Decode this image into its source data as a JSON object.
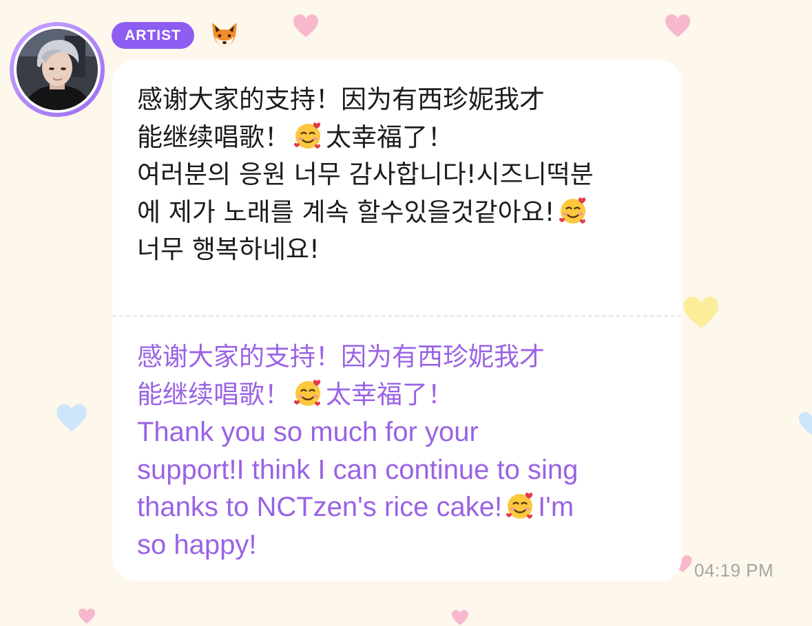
{
  "message": {
    "badge": "ARTIST",
    "sender_icon": "fox-icon",
    "original_lines": [
      "感谢大家的支持！因为有西珍妮我才",
      "能继续唱歌！",
      "太幸福了！",
      "여러분의 응원 너무 감사합니다!시즈니떡분",
      "에 제가 노래를 계속 할수있을것같아요!",
      "너무 행복하네요!"
    ],
    "translation_lines": [
      "感谢大家的支持！因为有西珍妮我才",
      "能继续唱歌！",
      "太幸福了！",
      "Thank you so much for your",
      "support!I think I can continue to sing",
      "thanks to NCTzen's rice cake!",
      "I'm",
      "so happy!"
    ],
    "emoji": "smiling-face-with-hearts-icon",
    "time": "04:19 PM"
  },
  "colors": {
    "background": "#fdf7ec",
    "badge": "#8d5cf0",
    "translation_text": "#9a62e4",
    "avatar_ring": "#a77cf5"
  }
}
